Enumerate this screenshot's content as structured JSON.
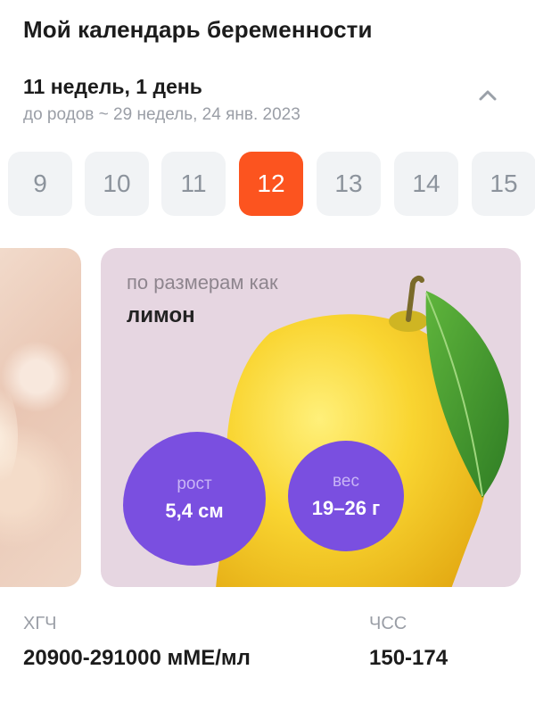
{
  "header": {
    "title": "Мой календарь беременности",
    "progress": "11 недель, 1 день",
    "due": "до родов ~ 29 недель, 24 янв. 2023"
  },
  "week_selector": {
    "weeks": [
      "9",
      "10",
      "11",
      "12",
      "13",
      "14",
      "15"
    ],
    "selected": "12",
    "accent_color": "#fc541f"
  },
  "size_card": {
    "label": "по размерам как",
    "fruit": "лимон",
    "height": {
      "label": "рост",
      "value": "5,4 см"
    },
    "weight": {
      "label": "вес",
      "value": "19–26 г"
    },
    "card_color": "#e6d6e1",
    "badge_color": "#7a4fe0"
  },
  "stats": {
    "hcg": {
      "label": "ХГЧ",
      "value": "20900-291000 мМЕ/мл"
    },
    "hr": {
      "label": "ЧСС",
      "value": "150-174"
    }
  },
  "icons": {
    "collapse": "chevron-up-icon"
  }
}
